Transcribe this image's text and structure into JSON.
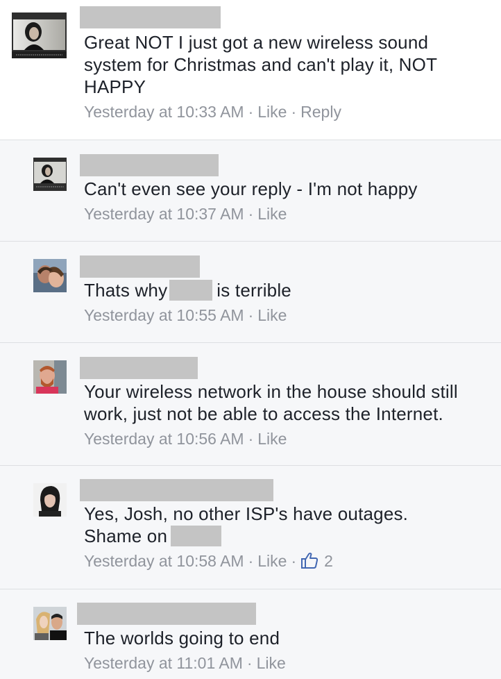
{
  "comments": [
    {
      "text_lines": [
        "Great NOT I just got a new wireless sound",
        "system for Christmas and can't play it, NOT",
        "HAPPY"
      ],
      "time": "Yesterday at 10:33 AM",
      "like": "Like",
      "reply": "Reply"
    },
    {
      "text": "Can't even see your reply - I'm not happy",
      "time": "Yesterday at 10:37 AM",
      "like": "Like"
    },
    {
      "text_before": "Thats why",
      "text_after": "is terrible",
      "time": "Yesterday at 10:55 AM",
      "like": "Like"
    },
    {
      "text_lines": [
        "Your wireless network in the house should still",
        "work, just not be able to access the Internet."
      ],
      "time": "Yesterday at 10:56 AM",
      "like": "Like"
    },
    {
      "text_line1": "Yes, Josh, no other ISP's have outages.",
      "text_line2": "Shame on",
      "time": "Yesterday at 10:58 AM",
      "like": "Like",
      "like_count": "2"
    },
    {
      "text": "The worlds going to end",
      "time": "Yesterday at 11:01 AM",
      "like": "Like"
    }
  ],
  "colors": {
    "redaction": "#c4c4c4",
    "meta_text": "#90949c",
    "like_icon": "#4267b2"
  },
  "icons": {
    "like_count_icon": "thumbs-up-icon"
  }
}
